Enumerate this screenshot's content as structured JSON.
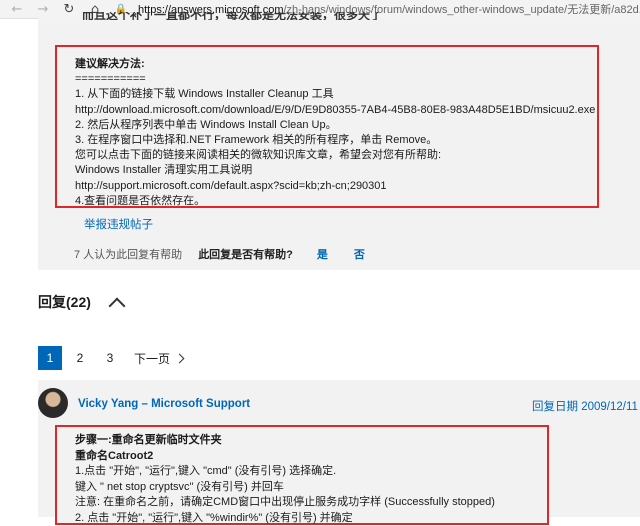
{
  "browser": {
    "url_host": "https://answers.microsoft.com",
    "url_path": "/zh-hans/windows/forum/windows_other-windows_update/无法更新/a82d..."
  },
  "post": {
    "cut_line": "而且这个补丁一直都不行，每次都是无法安装，很多天了",
    "solution_lines": [
      {
        "text": "建议解决方法:",
        "bold": true
      },
      {
        "text": "===========",
        "bold": false
      },
      {
        "text": "1. 从下面的链接下载 Windows Installer Cleanup 工具",
        "bold": false
      },
      {
        "text": "http://download.microsoft.com/download/E/9/D/E9D80355-7AB4-45B8-80E8-983A48D5E1BD/msicuu2.exe",
        "bold": false
      },
      {
        "text": "2. 然后从程序列表中单击 Windows Install Clean Up。",
        "bold": false
      },
      {
        "text": "3. 在程序窗口中选择和.NET Framework 相关的所有程序，单击 Remove。",
        "bold": false
      },
      {
        "text": "您可以点击下面的链接来阅读相关的微软知识库文章，希望会对您有所帮助:",
        "bold": false
      },
      {
        "text": "Windows Installer 清理实用工具说明",
        "bold": false
      },
      {
        "text": "http://support.microsoft.com/default.aspx?scid=kb;zh-cn;290301",
        "bold": false
      },
      {
        "text": "4.查看问题是否依然存在。",
        "bold": false
      }
    ],
    "report_label": "举报违规帖子",
    "helpful_count": "7 人认为此回复有帮助",
    "helpful_question": "此回复是否有帮助?",
    "yes_label": "是",
    "no_label": "否"
  },
  "replies": {
    "header": "回复(22)"
  },
  "pager": {
    "pages": [
      "1",
      "2",
      "3"
    ],
    "active": "1",
    "next_label": "下一页"
  },
  "reply": {
    "author": "Vicky Yang – Microsoft Support",
    "date": "回复日期 2009/12/11",
    "lines": [
      {
        "text": "步骤一:重命名更新临时文件夹",
        "bold": true
      },
      {
        "text": "重命名Catroot2",
        "bold": true
      },
      {
        "text": "1.点击 \"开始\", \"运行\",键入 \"cmd\" (没有引号) 选择确定.",
        "bold": false
      },
      {
        "text": "键入 \" net stop cryptsvc\" (没有引号) 并回车",
        "bold": false
      },
      {
        "text": "注意: 在重命名之前，请确定CMD窗口中出现停止服务成功字样 (Successfully stopped)",
        "bold": false
      },
      {
        "text": "2. 点击 \"开始\", \"运行\",键入 \"%windir%\" (没有引号) 并确定",
        "bold": false
      }
    ]
  }
}
